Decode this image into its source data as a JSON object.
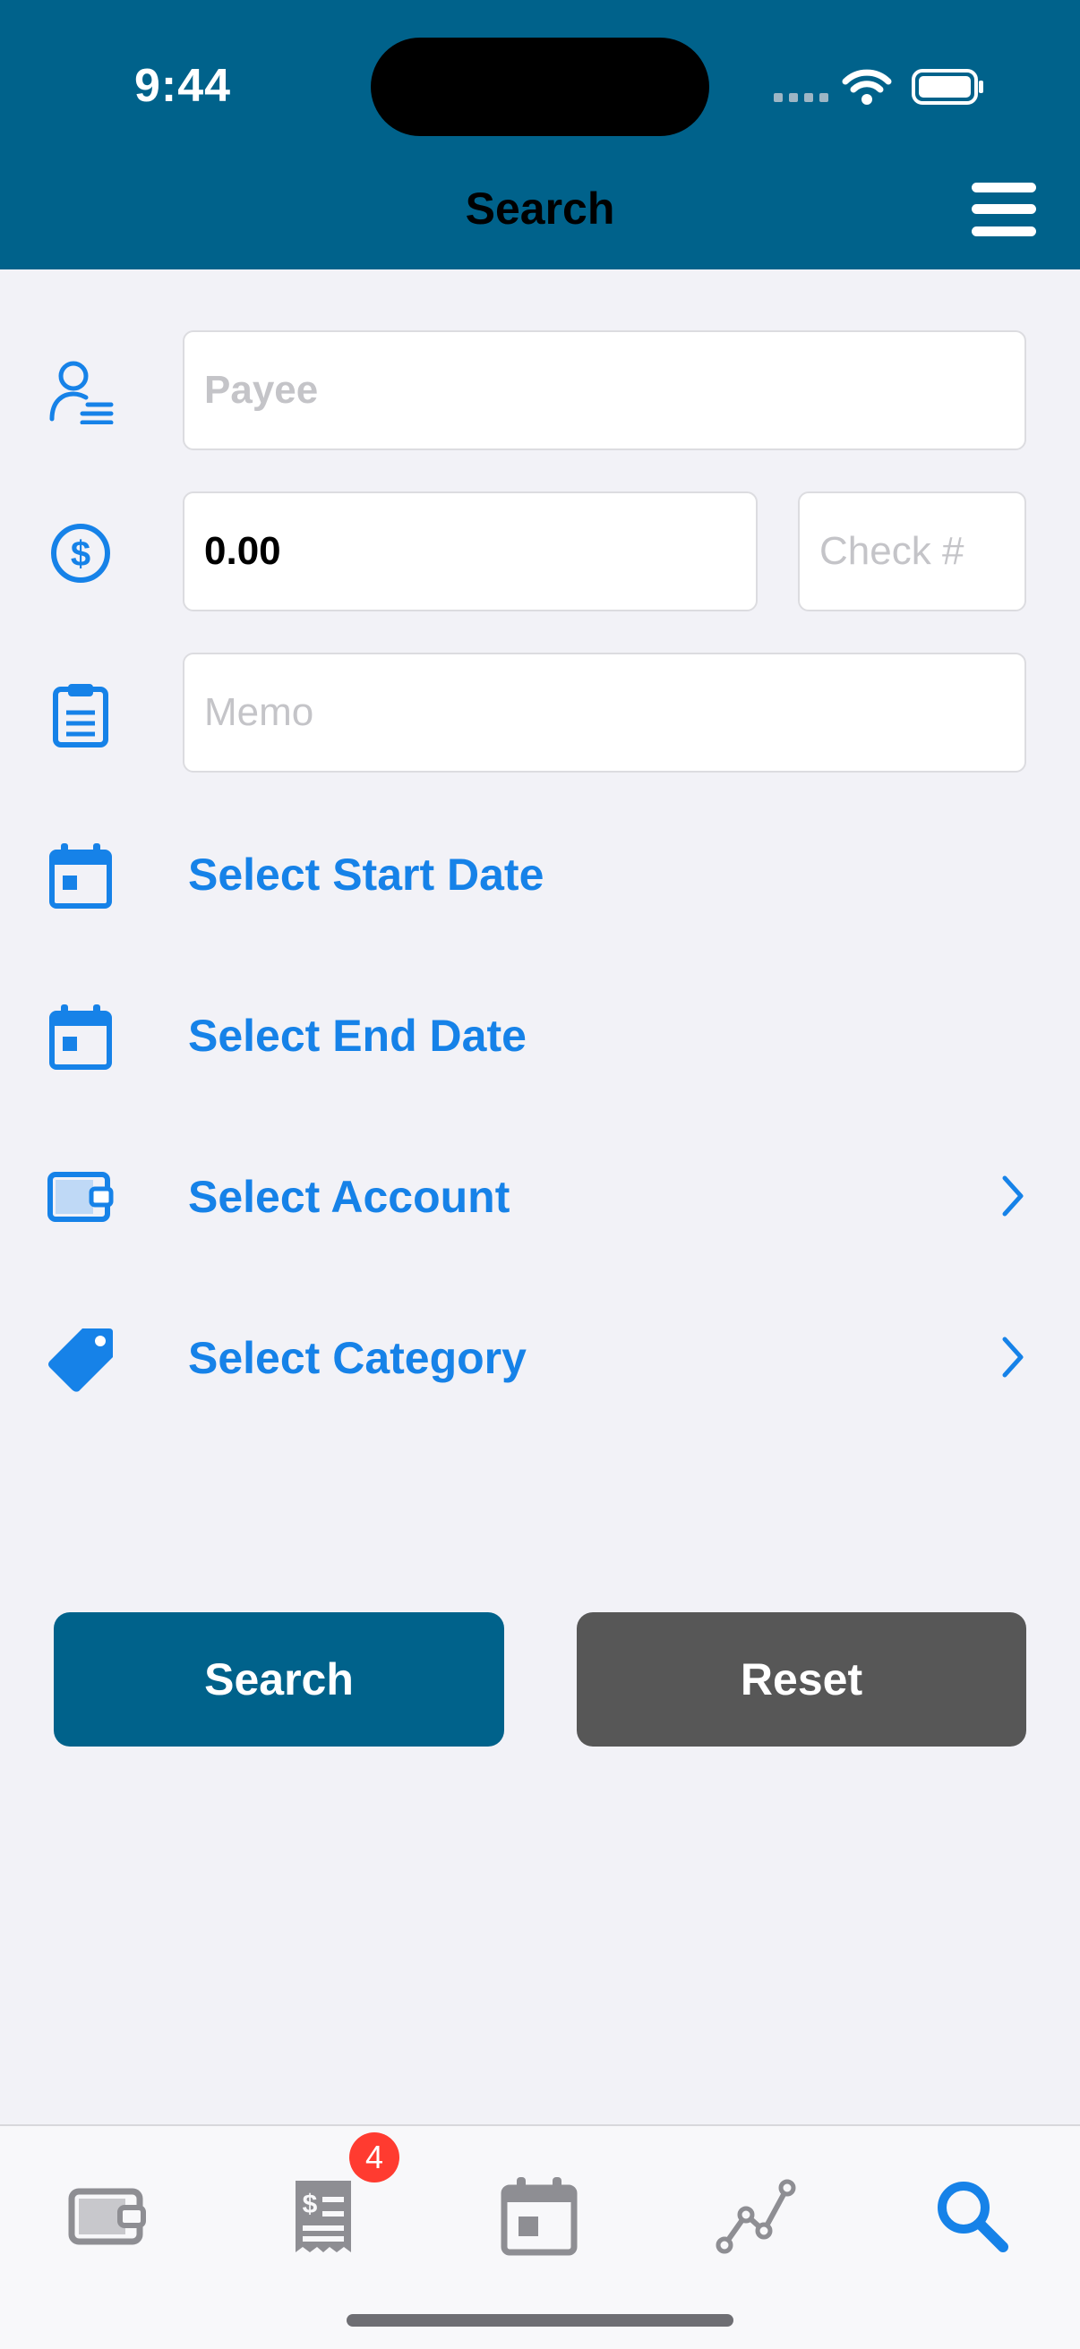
{
  "status_bar": {
    "time": "9:44"
  },
  "header": {
    "title": "Search"
  },
  "form": {
    "payee_placeholder": "Payee",
    "amount_value": "0.00",
    "check_placeholder": "Check #",
    "memo_placeholder": "Memo",
    "start_date_label": "Select Start Date",
    "end_date_label": "Select End Date",
    "account_label": "Select Account",
    "category_label": "Select Category"
  },
  "buttons": {
    "search_label": "Search",
    "reset_label": "Reset"
  },
  "tab_bar": {
    "tabs": [
      {
        "icon": "wallet-icon"
      },
      {
        "icon": "receipt-icon",
        "badge": "4"
      },
      {
        "icon": "calendar-icon"
      },
      {
        "icon": "chart-line-icon"
      },
      {
        "icon": "search-icon",
        "selected": true
      }
    ]
  },
  "colors": {
    "header_bg": "#00628B",
    "accent": "#1682E8",
    "search_button": "#00628B",
    "reset_button": "#575757",
    "badge": "#FF3B30",
    "inactive_tab": "#8E8E93"
  }
}
